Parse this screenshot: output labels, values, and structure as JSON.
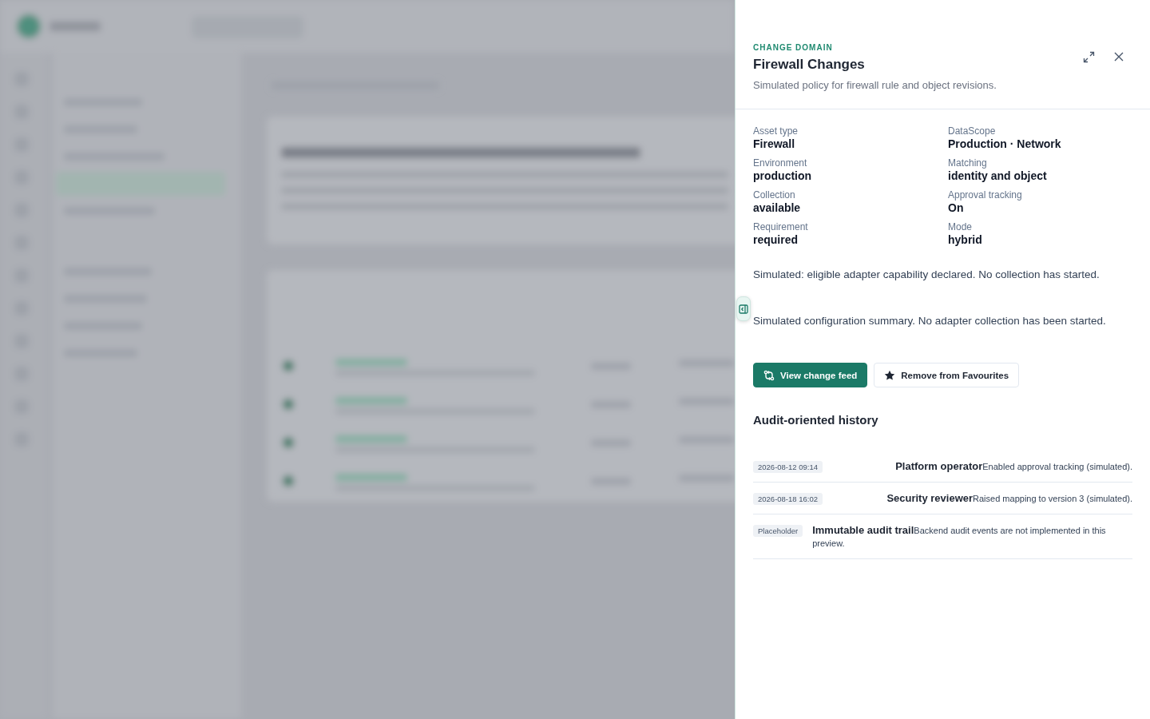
{
  "panel": {
    "eyebrow": "CHANGE DOMAIN",
    "title": "Firewall Changes",
    "description": "Simulated policy for firewall rule and object revisions.",
    "fields": [
      {
        "label": "Asset type",
        "value": "Firewall"
      },
      {
        "label": "DataScope",
        "value": "Production · Network"
      },
      {
        "label": "Environment",
        "value": "production"
      },
      {
        "label": "Matching",
        "value": "identity and object"
      },
      {
        "label": "Collection",
        "value": "available"
      },
      {
        "label": "Approval tracking",
        "value": "On"
      },
      {
        "label": "Requirement",
        "value": "required"
      },
      {
        "label": "Mode",
        "value": "hybrid"
      }
    ],
    "notes": [
      "Simulated: eligible adapter capability declared. No collection has started.",
      "Simulated configuration summary. No adapter collection has been started."
    ],
    "buttons": [
      {
        "label": "View change feed",
        "kind": "primary"
      },
      {
        "label": "Remove from Favourites",
        "kind": "secondary"
      }
    ],
    "history_title": "Audit-oriented history",
    "history": [
      {
        "tag": "2026-08-12 09:14",
        "actor": "Platform operator",
        "text": "Enabled approval tracking (simulated)."
      },
      {
        "tag": "2026-08-18 16:02",
        "actor": "Security reviewer",
        "text": "Raised mapping to version 3 (simulated)."
      },
      {
        "tag": "Placeholder",
        "actor": "Immutable audit trail",
        "text": "Backend audit events are not implemented in this preview."
      }
    ]
  }
}
